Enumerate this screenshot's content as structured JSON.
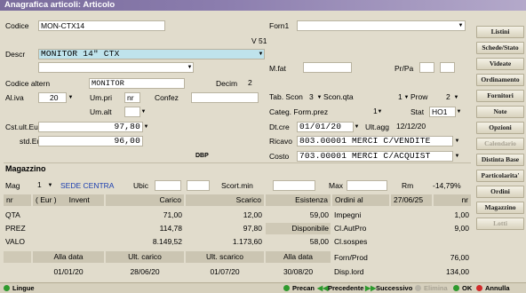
{
  "window": {
    "title": "Anagrafica articoli: Articolo"
  },
  "form": {
    "codice_label": "Codice",
    "codice_value": "MON-CTX14",
    "version": "V 51",
    "descr_label": "Descr",
    "descr_value": "MONITOR 14\" CTX",
    "codice_altern_label": "Codice altern",
    "codice_altern_value": "MONITOR",
    "decim_label": "Decim",
    "decim_value": "2",
    "aliva_label": "Al.iva",
    "aliva_value": "20",
    "umpri_label": "Um.pri",
    "umpri_value": "nr",
    "confez_label": "Confez",
    "umalt_label": "Um.alt",
    "cst_ult_label": "Cst.ult.Eur",
    "cst_ult_value": "97,80",
    "std_eur_label": "std.Eur",
    "std_eur_value": "96,00",
    "dbp_label": "DBP",
    "forn1_label": "Forn1",
    "mfat_label": "M.fat",
    "prpa_label": "Pr/Pa",
    "tab_scon_label": "Tab. Scon",
    "tab_scon_value": "3",
    "scon_qta_label": "Scon.qta",
    "scon_qta_value": "1",
    "prow_label": "Prow",
    "prow_value": "2",
    "categ_label": "Categ. Form.prez",
    "categ_value": "1",
    "stat_label": "Stat",
    "stat_value": "HO1",
    "dtcre_label": "Dt.cre",
    "dtcre_value": "01/01/20",
    "ultagg_label": "Ult.agg",
    "ultagg_value": "12/12/20",
    "ricavo_label": "Ricavo",
    "ricavo_value": "803.00001 MERCI C/VENDITE",
    "costo_label": "Costo",
    "costo_value": "703.00001 MERCI C/ACQUIST"
  },
  "magazzino": {
    "title": "Magazzino",
    "mag_label": "Mag",
    "mag_value": "1",
    "sede": "SEDE CENTRA",
    "ubic_label": "Ubic",
    "scort_min_label": "Scort.min",
    "max_label": "Max",
    "rm_label": "Rm",
    "rm_value": "-14,79%",
    "headers": [
      "nr",
      "( Eur )",
      "Invent",
      "Carico",
      "Scarico",
      "Esistenza",
      "Ordini al",
      "27/06/25",
      "nr"
    ],
    "rows": [
      {
        "label": "QTA",
        "invent": "",
        "carico": "71,00",
        "scarico": "12,00",
        "esistenza": "59,00",
        "desc": "Impegni",
        "val": "1,00"
      },
      {
        "label": "PREZ",
        "invent": "",
        "carico": "114,78",
        "scarico": "97,80",
        "esistenza": "Disponibile",
        "desc": "Cl.AutPro",
        "val": "9,00"
      },
      {
        "label": "VALO",
        "invent": "",
        "carico": "8.149,52",
        "scarico": "1.173,60",
        "esistenza": "58,00",
        "desc": "Cl.sospes",
        "val": ""
      }
    ],
    "footer_headers": [
      "Alla data",
      "Ult. carico",
      "Ult. scarico",
      "Alla data"
    ],
    "footer_values": [
      "01/01/20",
      "28/06/20",
      "01/07/20",
      "30/08/20"
    ],
    "forn_prod_label": "Forn/Prod",
    "forn_prod_value": "76,00",
    "disp_lord_label": "Disp.lord",
    "disp_lord_value": "134,00"
  },
  "sidebar": {
    "buttons": [
      {
        "label": "Listini",
        "enabled": true
      },
      {
        "label": "Schede/Stato",
        "enabled": true
      },
      {
        "label": "Videate",
        "enabled": true
      },
      {
        "label": "Ordinamento",
        "enabled": true
      },
      {
        "label": "Fornitori",
        "enabled": true
      },
      {
        "label": "Note",
        "enabled": true
      },
      {
        "label": "Opzioni",
        "enabled": true
      },
      {
        "label": "Calendario",
        "enabled": false
      },
      {
        "label": "Distinta Base",
        "enabled": true
      },
      {
        "label": "Particolarita'",
        "enabled": true
      },
      {
        "label": "Ordini",
        "enabled": true
      },
      {
        "label": "Magazzino",
        "enabled": true
      },
      {
        "label": "Lotti",
        "enabled": false
      }
    ]
  },
  "toolbar": {
    "lingue": "Lingue",
    "precan": "Precan",
    "precedente": "Precedente",
    "successivo": "Successivo",
    "elimina": "Elimina",
    "ok": "OK",
    "annulla": "Annulla"
  }
}
